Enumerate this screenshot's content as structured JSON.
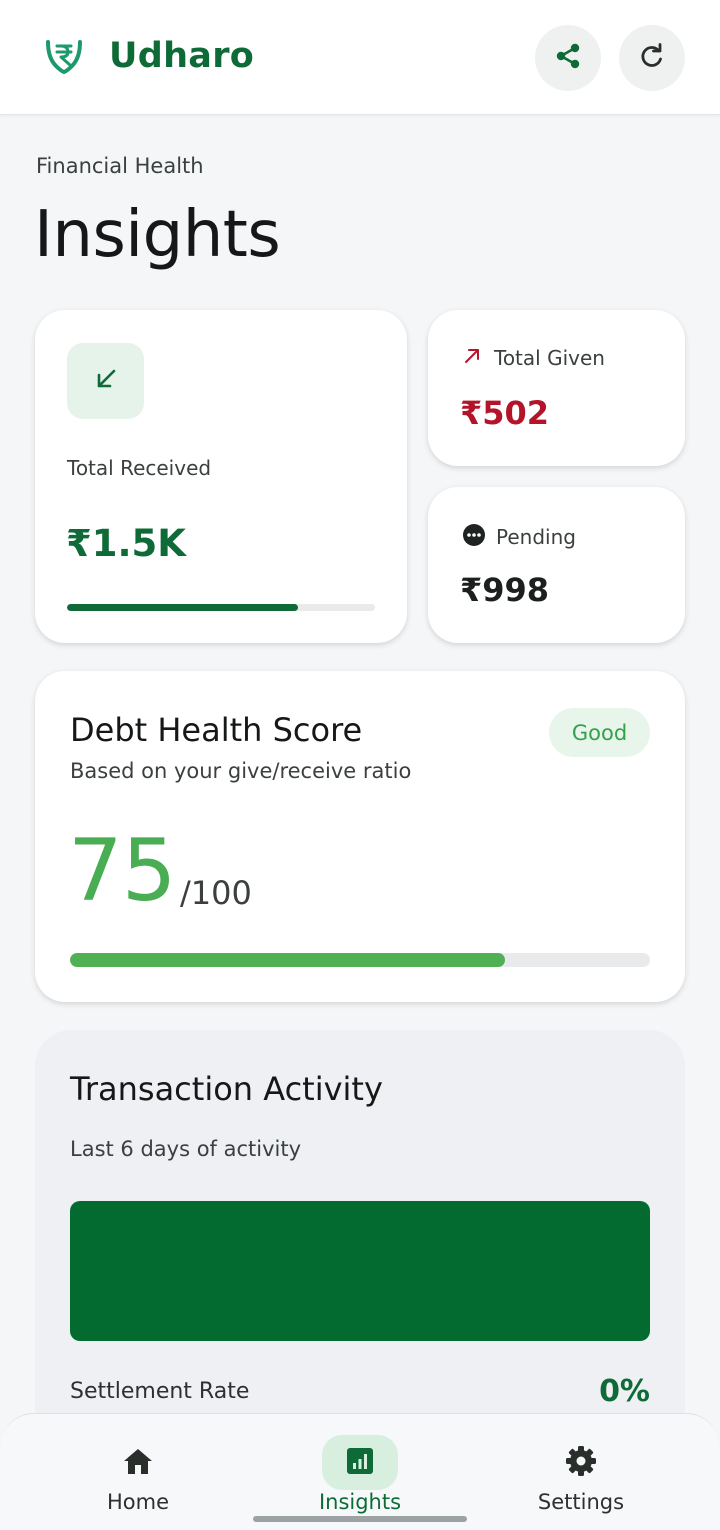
{
  "colors": {
    "brand": "#0e6b37",
    "given": "#b3142a",
    "score": "#49ad53",
    "badge_bg": "#e7f5eb",
    "activity_bar": "#036b30",
    "background": "#f4f6f8"
  },
  "header": {
    "app_name": "Udharo",
    "logo_icon": "rupee-shield-icon",
    "share_icon": "share-icon",
    "refresh_icon": "refresh-icon"
  },
  "page": {
    "eyebrow": "Financial Health",
    "title": "Insights"
  },
  "summary": {
    "received": {
      "label": "Total Received",
      "value": "₹1.5K",
      "icon": "arrow-down-left-icon",
      "progress": 0.75
    },
    "given": {
      "label": "Total Given",
      "value": "₹502",
      "icon": "arrow-up-right-icon"
    },
    "pending": {
      "label": "Pending",
      "value": "₹998",
      "icon": "more-horizontal-circle-icon"
    }
  },
  "health": {
    "title": "Debt Health Score",
    "subtitle": "Based on your give/receive ratio",
    "badge": "Good",
    "score": "75",
    "max": "/100",
    "progress": 0.75
  },
  "activity": {
    "title": "Transaction Activity",
    "subtitle": "Last 6 days of activity",
    "settlement_label": "Settlement Rate",
    "settlement_value": "0%"
  },
  "nav": {
    "items": [
      {
        "label": "Home",
        "icon": "home-icon",
        "active": false
      },
      {
        "label": "Insights",
        "icon": "bar-chart-icon",
        "active": true
      },
      {
        "label": "Settings",
        "icon": "gear-icon",
        "active": false
      }
    ]
  }
}
